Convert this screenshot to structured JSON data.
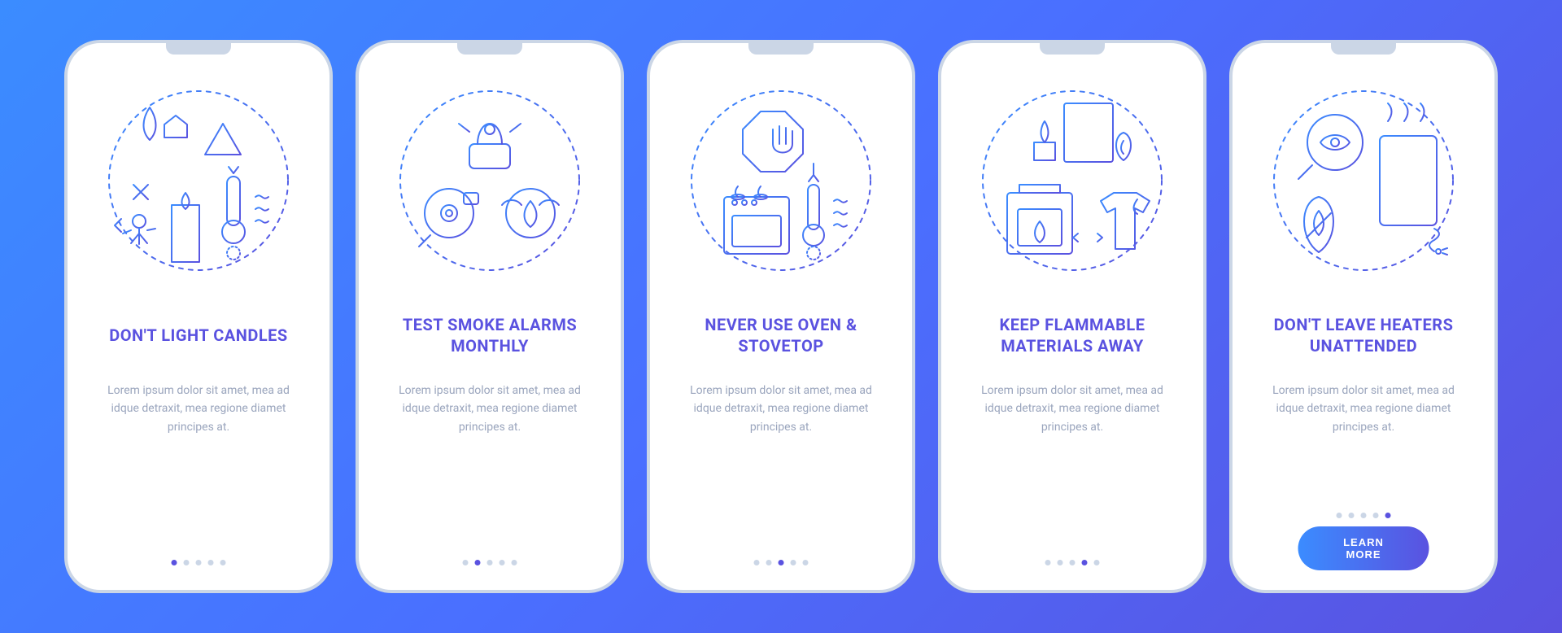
{
  "colors": {
    "bg_grad_from": "#3b8cff",
    "bg_grad_to": "#5a52e0",
    "title": "#5a52e0",
    "body": "#9aa5bd",
    "dot_inactive": "#cbd6e6",
    "dot_active": "#5a52e0",
    "btn_grad_from": "#3b8cff",
    "btn_grad_to": "#5a52e0"
  },
  "screens": [
    {
      "icon": "candle-warning-icon",
      "title": "DON'T LIGHT CANDLES",
      "desc": "Lorem ipsum dolor sit amet, mea ad idque detraxit, mea regione diamet principes at.",
      "active_dot": 0,
      "has_button": false
    },
    {
      "icon": "smoke-alarm-icon",
      "title": "TEST SMOKE ALARMS MONTHLY",
      "desc": "Lorem ipsum dolor sit amet, mea ad idque detraxit, mea regione diamet principes at.",
      "active_dot": 1,
      "has_button": false
    },
    {
      "icon": "oven-stop-icon",
      "title": "NEVER USE OVEN & STOVETOP",
      "desc": "Lorem ipsum dolor sit amet, mea ad idque detraxit, mea regione diamet principes at.",
      "active_dot": 2,
      "has_button": false
    },
    {
      "icon": "flammable-away-icon",
      "title": "KEEP FLAMMABLE MATERIALS AWAY",
      "desc": "Lorem ipsum dolor sit amet, mea ad idque detraxit, mea regione diamet principes at.",
      "active_dot": 3,
      "has_button": false
    },
    {
      "icon": "heater-watch-icon",
      "title": "DON'T LEAVE HEATERS UNATTENDED",
      "desc": "Lorem ipsum dolor sit amet, mea ad idque detraxit, mea regione diamet principes at.",
      "active_dot": 4,
      "has_button": true
    }
  ],
  "button_label": "LEARN MORE",
  "dot_count": 5
}
